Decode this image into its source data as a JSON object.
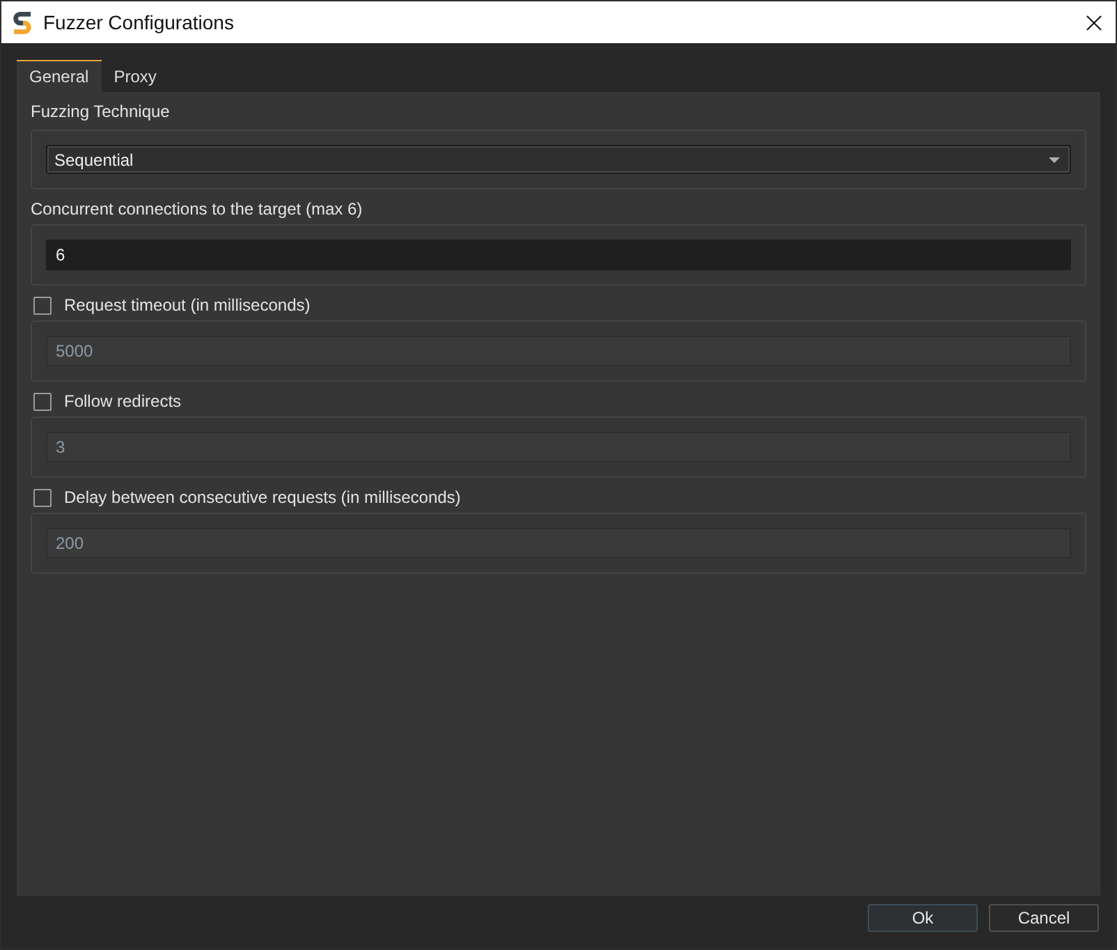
{
  "window": {
    "title": "Fuzzer Configurations"
  },
  "tabs": [
    {
      "label": "General",
      "selected": true
    },
    {
      "label": "Proxy",
      "selected": false
    }
  ],
  "settings": [
    {
      "kind": "select",
      "label": "Fuzzing Technique",
      "value": "Sequential"
    },
    {
      "kind": "input",
      "label": "Concurrent connections to the target (max 6)",
      "value": "6",
      "disabled": false
    },
    {
      "kind": "checkbox-input",
      "label": "Request timeout (in milliseconds)",
      "checked": false,
      "value": "5000",
      "disabled": true
    },
    {
      "kind": "checkbox-input",
      "label": "Follow redirects",
      "checked": false,
      "value": "3",
      "disabled": true
    },
    {
      "kind": "checkbox-input",
      "label": "Delay between consecutive requests (in milliseconds)",
      "checked": false,
      "value": "200",
      "disabled": true
    }
  ],
  "buttons": [
    {
      "label": "Ok",
      "default": true
    },
    {
      "label": "Cancel",
      "default": false
    }
  ]
}
